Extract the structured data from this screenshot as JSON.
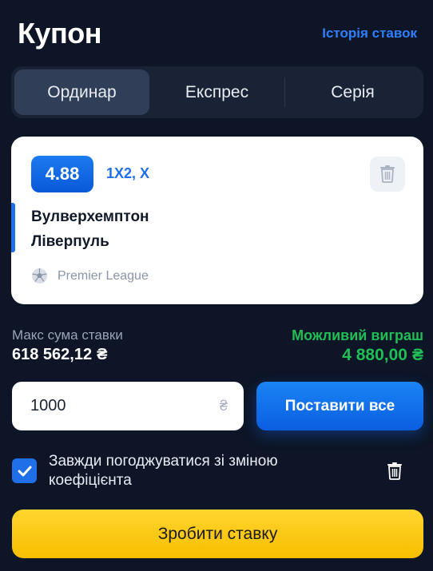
{
  "header": {
    "title": "Купон",
    "history_link": "Історія ставок"
  },
  "tabs": [
    {
      "label": "Ординар",
      "active": true
    },
    {
      "label": "Експрес",
      "active": false
    },
    {
      "label": "Серія",
      "active": false
    }
  ],
  "bet": {
    "odds": "4.88",
    "market": "1X2, X",
    "team_home": "Вулверхемптон",
    "team_away": "Ліверпуль",
    "league": "Premier League",
    "league_icon": "soccer-ball-icon"
  },
  "limits": {
    "max_label": "Макс сума ставки",
    "max_value": "618 562,12",
    "currency": "₴",
    "win_label": "Можливий виграш",
    "win_value": "4 880,00"
  },
  "stake": {
    "value": "1000",
    "currency": "₴"
  },
  "place_all_label": "Поставити все",
  "accept_odds": {
    "checked": true,
    "label": "Завжди погоджуватися зі зміною коефіцієнта"
  },
  "submit_label": "Зробити ставку",
  "colors": {
    "background": "#0d1526",
    "accent_blue": "#1f6fe8",
    "win_green": "#1fbf55",
    "submit_yellow": "#ffd52e"
  }
}
